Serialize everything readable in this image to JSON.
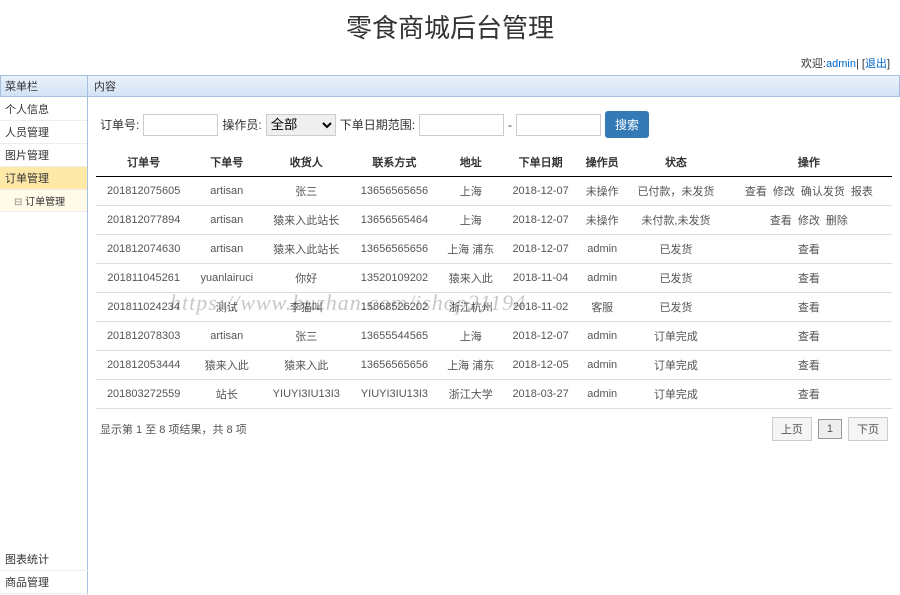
{
  "header": {
    "title": "零食商城后台管理"
  },
  "userbar": {
    "welcome": "欢迎:",
    "username": "admin",
    "logout": "退出"
  },
  "sidebar": {
    "header": "菜单栏",
    "items": [
      {
        "label": "个人信息"
      },
      {
        "label": "人员管理"
      },
      {
        "label": "图片管理"
      },
      {
        "label": "订单管理"
      }
    ],
    "sub": {
      "label": "订单管理"
    },
    "bottom": [
      {
        "label": "图表统计"
      },
      {
        "label": "商品管理"
      }
    ]
  },
  "content": {
    "header": "内容"
  },
  "filter": {
    "orderNoLabel": "订单号:",
    "operatorLabel": "操作员:",
    "operatorValue": "全部",
    "dateRangeLabel": "下单日期范围:",
    "searchLabel": "搜索"
  },
  "columns": [
    "订单号",
    "下单号",
    "收货人",
    "联系方式",
    "地址",
    "下单日期",
    "操作员",
    "状态",
    "操作"
  ],
  "rows": [
    {
      "orderNo": "201812075605",
      "placer": "artisan",
      "receiver": "张三",
      "phone": "13656565656",
      "addr": "上海",
      "date": "2018-12-07",
      "op": "未操作",
      "status": "已付款，未发货",
      "actions": [
        "查看",
        "修改",
        "确认发货",
        "报表"
      ]
    },
    {
      "orderNo": "201812077894",
      "placer": "artisan",
      "receiver": "猿来入此站长",
      "phone": "13656565464",
      "addr": "上海",
      "date": "2018-12-07",
      "op": "未操作",
      "status": "未付款,未发货",
      "actions": [
        "查看",
        "修改",
        "删除"
      ]
    },
    {
      "orderNo": "201812074630",
      "placer": "artisan",
      "receiver": "猿来入此站长",
      "phone": "13656565656",
      "addr": "上海 浦东",
      "date": "2018-12-07",
      "op": "admin",
      "status": "已发货",
      "actions": [
        "查看"
      ]
    },
    {
      "orderNo": "201811045261",
      "placer": "yuanlairuci",
      "receiver": "你好",
      "phone": "13520109202",
      "addr": "猿来入此",
      "date": "2018-11-04",
      "op": "admin",
      "status": "已发货",
      "actions": [
        "查看"
      ]
    },
    {
      "orderNo": "201811024234",
      "placer": "测试",
      "receiver": "李猫叫",
      "phone": "15868526202",
      "addr": "浙江杭州",
      "date": "2018-11-02",
      "op": "客服",
      "status": "已发货",
      "actions": [
        "查看"
      ]
    },
    {
      "orderNo": "201812078303",
      "placer": "artisan",
      "receiver": "张三",
      "phone": "13655544565",
      "addr": "上海",
      "date": "2018-12-07",
      "op": "admin",
      "status": "订单完成",
      "actions": [
        "查看"
      ]
    },
    {
      "orderNo": "201812053444",
      "placer": "猿来入此",
      "receiver": "猿来入此",
      "phone": "13656565656",
      "addr": "上海 浦东",
      "date": "2018-12-05",
      "op": "admin",
      "status": "订单完成",
      "actions": [
        "查看"
      ]
    },
    {
      "orderNo": "201803272559",
      "placer": "站长",
      "receiver": "YIUYI3IU13I3",
      "phone": "YIUYI3IU13I3",
      "addr": "浙江大学",
      "date": "2018-03-27",
      "op": "admin",
      "status": "订单完成",
      "actions": [
        "查看"
      ]
    }
  ],
  "footer": {
    "summary": "显示第 1 至 8 项结果，共 8 项",
    "prev": "上页",
    "page": "1",
    "next": "下页"
  },
  "watermark": "https://www.huzhan.com/ishop21194"
}
